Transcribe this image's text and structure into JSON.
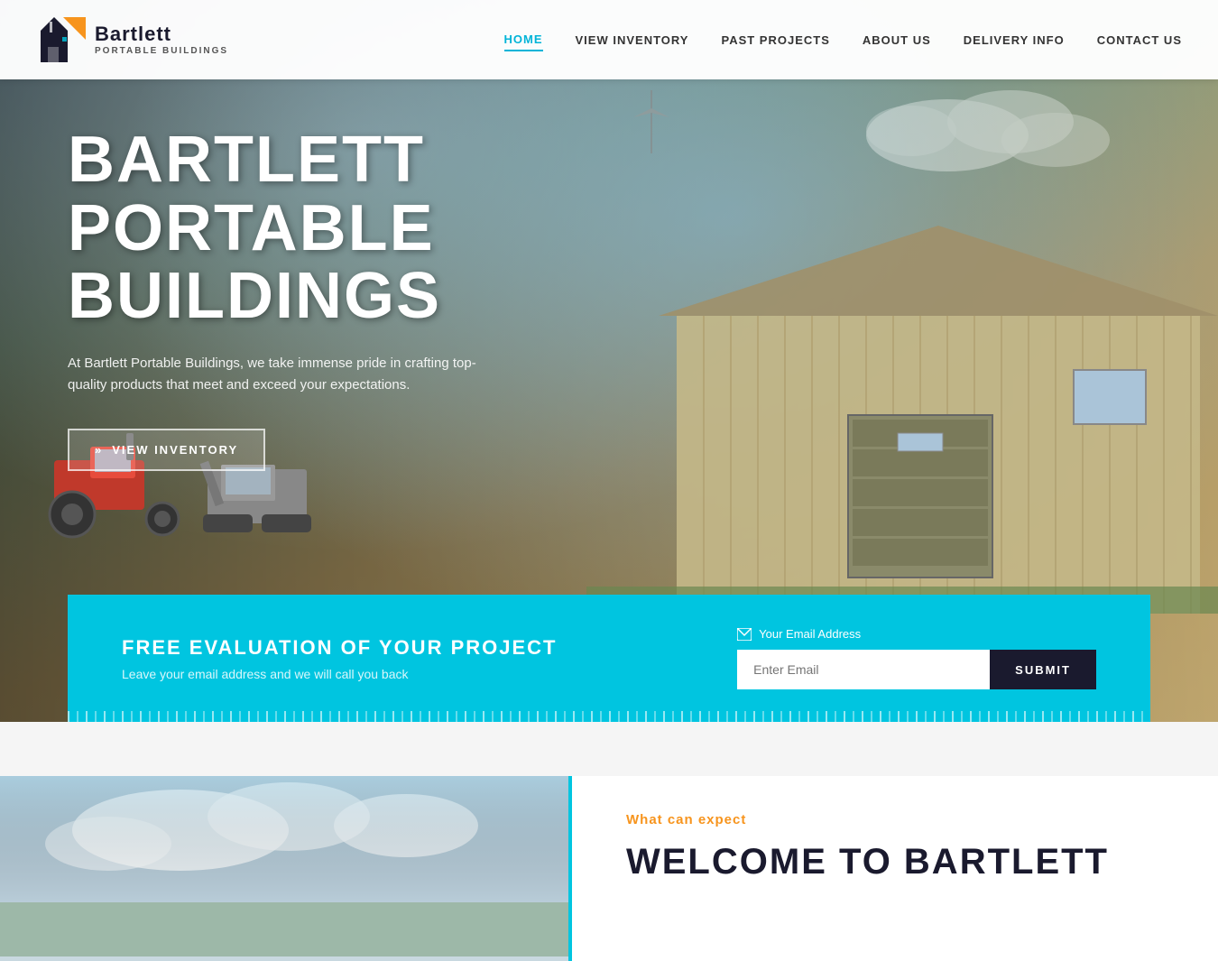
{
  "logo": {
    "company_name": "Bartlett",
    "company_sub": "PORTABLE BUILDINGS"
  },
  "nav": {
    "items": [
      {
        "label": "HOME",
        "id": "home",
        "active": true
      },
      {
        "label": "VIEW INVENTORY",
        "id": "view-inventory",
        "active": false
      },
      {
        "label": "PAST PROJECTS",
        "id": "past-projects",
        "active": false
      },
      {
        "label": "ABOUT US",
        "id": "about-us",
        "active": false
      },
      {
        "label": "DELIVERY INFO",
        "id": "delivery-info",
        "active": false
      },
      {
        "label": "CONTACT US",
        "id": "contact-us",
        "active": false
      }
    ]
  },
  "hero": {
    "title_line1": "BARTLETT PORTABLE",
    "title_line2": "BUILDINGS",
    "description": "At Bartlett Portable Buildings, we take immense pride in crafting top-quality products that meet and exceed your expectations.",
    "cta_label": "VIEW INVENTORY",
    "cta_icon": "»"
  },
  "email_section": {
    "heading": "FREE EVALUATION OF YOUR PROJECT",
    "subtext": "Leave your email address and we will call you back",
    "email_label": "Your Email Address",
    "email_placeholder": "Enter Email",
    "submit_label": "SUBMIT"
  },
  "below_section": {
    "tag": "What can expect",
    "title_line1": "WELCOME TO BARTLETT"
  }
}
